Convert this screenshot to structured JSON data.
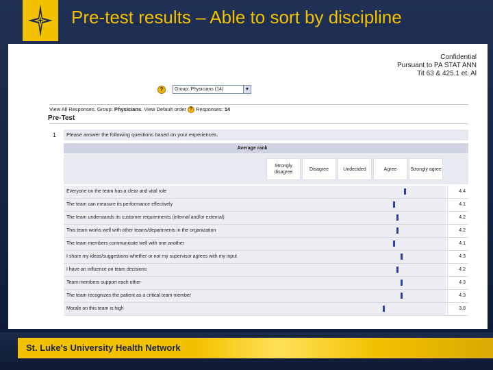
{
  "slide": {
    "title": "Pre-test results – Able to sort by discipline",
    "footer": "St. Luke's University Health Network"
  },
  "confidential": {
    "line1": "Confidential",
    "line2": "Pursuant to PA STAT ANN",
    "line3": "Tit 63 & 425.1 et. Al"
  },
  "top_dash": "-",
  "group_select": {
    "value": "Group: Physicians (14)"
  },
  "view_line": {
    "prefix": "View All Responses. Group: ",
    "group": "Physicians",
    "middle": ". View Default order",
    "responses_label": "Responses: ",
    "responses_count": "14"
  },
  "section": {
    "title": "Pre-Test",
    "question_number": "1",
    "question_text": "Please answer the following questions based on your experiences.",
    "average_rank_label": "Average rank",
    "scale": [
      "Strongly disagree",
      "Disagree",
      "Undecided",
      "Agree",
      "Strongly agree"
    ]
  },
  "rows": [
    {
      "label": "Everyone on the team has a clear and vital role",
      "value": "4.4",
      "rank": 4.4
    },
    {
      "label": "The team can measure its performance effectively",
      "value": "4.1",
      "rank": 4.1
    },
    {
      "label": "The team understands its customer requirements (internal and/or external)",
      "value": "4.2",
      "rank": 4.2
    },
    {
      "label": "This team works well with other teams/departments in the organization",
      "value": "4.2",
      "rank": 4.2
    },
    {
      "label": "The team members communicate well with one another",
      "value": "4.1",
      "rank": 4.1
    },
    {
      "label": "I share my ideas/suggestions whether or not my supervisor agrees with my input",
      "value": "4.3",
      "rank": 4.3
    },
    {
      "label": "I have an influence on team decisions",
      "value": "4.2",
      "rank": 4.2
    },
    {
      "label": "Team members support each other",
      "value": "4.3",
      "rank": 4.3
    },
    {
      "label": "The team recognizes the patient as a critical team member",
      "value": "4.3",
      "rank": 4.3
    },
    {
      "label": "Morale on this team is high",
      "value": "3.8",
      "rank": 3.8
    }
  ],
  "colors": {
    "title": "#f2c200",
    "marker": "#2b3fae",
    "footer_bar": "#f2c200"
  }
}
